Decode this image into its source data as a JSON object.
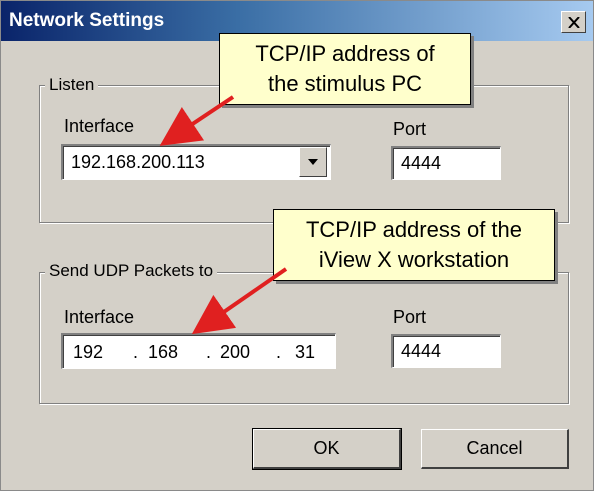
{
  "window": {
    "title": "Network Settings",
    "close_icon": "close-icon"
  },
  "listen": {
    "legend": "Listen",
    "interface_label": "Interface",
    "interface_value": "192.168.200.113",
    "dropdown_icon": "chevron-down-icon",
    "port_label": "Port",
    "port_value": "4444"
  },
  "send_udp": {
    "legend": "Send UDP Packets to",
    "interface_label": "Interface",
    "ip_octets": [
      "192",
      "168",
      "200",
      "31"
    ],
    "ip_separator": ".",
    "port_label": "Port",
    "port_value": "4444"
  },
  "buttons": {
    "ok_label": "OK",
    "cancel_label": "Cancel"
  },
  "annotations": {
    "callout_1_line1": "TCP/IP address of",
    "callout_1_line2": "the stimulus PC",
    "callout_2_line1": "TCP/IP address of the",
    "callout_2_line2": "iView X workstation",
    "arrow_color": "#e02020",
    "callout_color": "#ffffcc"
  }
}
